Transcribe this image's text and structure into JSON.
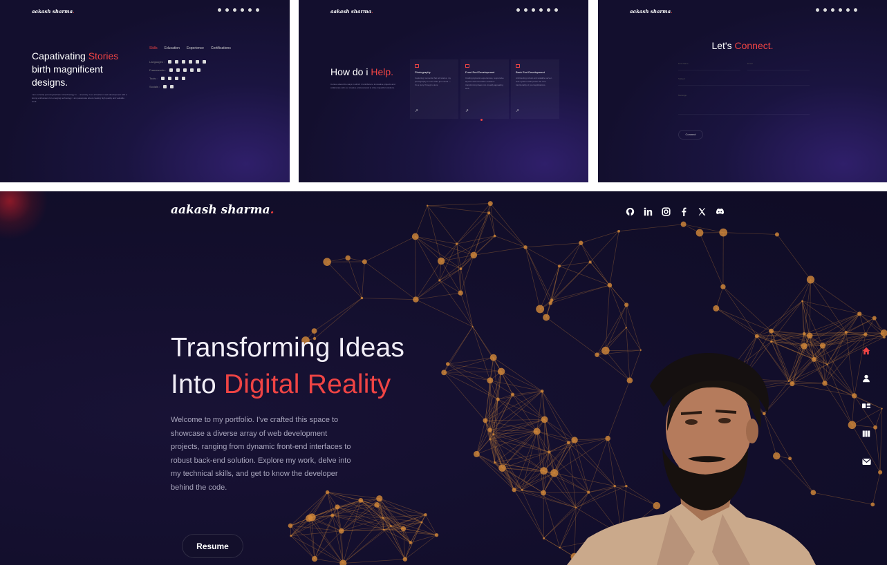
{
  "brand": {
    "name": "aakash sharma",
    "dot": "."
  },
  "social_icons": [
    "github-icon",
    "linkedin-icon",
    "instagram-icon",
    "facebook-icon",
    "x-icon",
    "discord-icon"
  ],
  "colors": {
    "accent": "#ef4444",
    "background": "#130f2e",
    "network": "#d48a3a"
  },
  "skills_panel": {
    "title_part1": "Capativating ",
    "title_highlight": "Stories",
    "title_part2": "birth magnificent designs.",
    "description": "I am currently pursuing bachelor of technology in ... university. I am a fresher in web development with a strong enthusiasm for emerging technology. I am passionate about creating high quality and valuable work.",
    "tabs": [
      "Skills",
      "Education",
      "Experience",
      "Certifications"
    ],
    "rows": [
      {
        "label": "Languages :"
      },
      {
        "label": "Frameworks :"
      },
      {
        "label": "Tools :"
      },
      {
        "label": "Socials :"
      }
    ]
  },
  "help_panel": {
    "title_part1": "How do i ",
    "title_highlight": "Help.",
    "description": "Curious about the ways in which I contribute to innovative projects and collaborate with our creative professionals to drive impactful solutions.",
    "cards": [
      {
        "title": "Photography",
        "text": "Capturing moments that tell stories, my photography is more than just visual — it's a story through a lens."
      },
      {
        "title": "Front End Development",
        "text": "Crafting dynamic experiences, responsive layouts and innovative solutions transforming ideas into visually appealing web."
      },
      {
        "title": "Back End Development",
        "text": "Architecting robust and scalable server-side systems that power the core functionality of your applications."
      }
    ]
  },
  "connect_panel": {
    "title_part1": "Let's ",
    "title_highlight": "Connect.",
    "fields": [
      "First Name",
      "Email",
      "Subject",
      "Message"
    ],
    "button": "Connect"
  },
  "hero": {
    "title_line1": "Transforming Ideas",
    "title_line2_plain": "Into ",
    "title_line2_highlight": "Digital Reality",
    "intro": "Welcome to my portfolio. I've crafted this space to showcase a diverse array of web development projects, ranging from dynamic front-end interfaces to robust back-end solution. Explore my work, delve into my technical skills, and get to know the developer behind the code.",
    "resume_button": "Resume",
    "side_nav": [
      "home-icon",
      "user-icon",
      "skills-icon",
      "projects-icon",
      "mail-icon"
    ]
  }
}
